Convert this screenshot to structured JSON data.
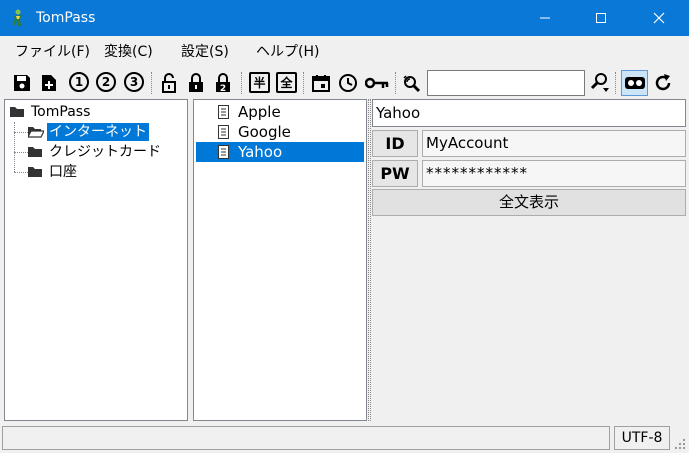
{
  "window": {
    "title": "TomPass"
  },
  "menu": [
    {
      "label": "ファイル(F)"
    },
    {
      "label": "変換(C)"
    },
    {
      "label": "設定(S)"
    },
    {
      "label": "ヘルプ(H)"
    }
  ],
  "toolbar": {
    "num1": "1",
    "num2": "2",
    "num3": "3",
    "lock_num": "2",
    "half_label": "半",
    "full_label": "全",
    "search_value": ""
  },
  "tree": {
    "root": "TomPass",
    "children": [
      {
        "label": "インターネット"
      },
      {
        "label": "クレジットカード"
      },
      {
        "label": "口座"
      }
    ]
  },
  "list": {
    "items": [
      {
        "label": "Apple"
      },
      {
        "label": "Google"
      },
      {
        "label": "Yahoo"
      }
    ]
  },
  "detail": {
    "title": "Yahoo",
    "id_label": "ID",
    "id_value": "MyAccount",
    "pw_label": "PW",
    "pw_value": "************",
    "show_all_label": "全文表示"
  },
  "status": {
    "message": "",
    "encoding": "UTF-8"
  },
  "colors": {
    "titlebar": "#0a78d7",
    "selection": "#0078d7",
    "toggle_active": "#cce4f7"
  }
}
